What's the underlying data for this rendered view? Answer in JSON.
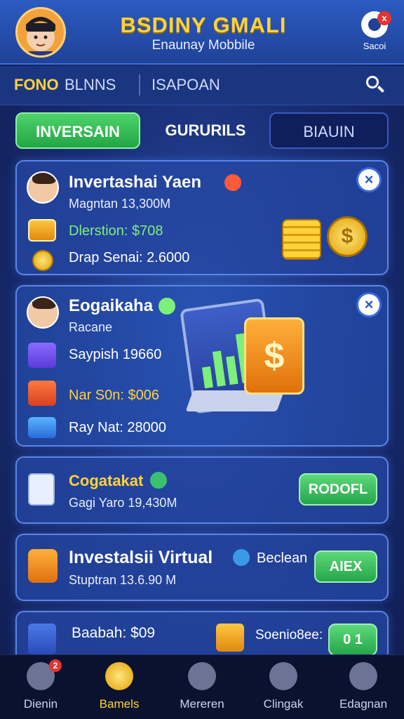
{
  "header": {
    "title": "BSDINY GMALI",
    "subtitle": "Enaunay Mobbile",
    "settings_label": "Sacoi",
    "settings_badge": "x"
  },
  "nav": {
    "items": [
      "FONO",
      "BLNNS",
      "ISAPOAN"
    ]
  },
  "tabs": [
    "INVERSAIN",
    "GURURILS",
    "BIAUIN"
  ],
  "cards": [
    {
      "title": "Invertashai Yaen",
      "subtitle": "Magntan 13,300M",
      "row1": "Dlerstion: $708",
      "row2": "Drap Senai: 2.6000",
      "close": "×"
    },
    {
      "title": "Eogaikaha",
      "subtitle": "Racane",
      "row1": "Saypish 19660",
      "row2": "Nar S0n: $006",
      "row3": "Ray Nat: 28000",
      "close": "×"
    },
    {
      "title": "Cogatakat",
      "subtitle": "Gagi Yaro 19,430M",
      "button": "RODOFL"
    },
    {
      "title": "Investalsii Virtual",
      "subtitle": "Stuptran 13.6.90 M",
      "side_label": "Beclean",
      "button": "AIEX"
    },
    {
      "title": "Baabah: $09",
      "side_label": "Soenio8ee:",
      "button": "0 1"
    }
  ],
  "bottom_nav": {
    "items": [
      {
        "label": "Dienin",
        "icon": "home-icon",
        "badge": "2"
      },
      {
        "label": "Bamels",
        "icon": "coin-icon"
      },
      {
        "label": "Mereren",
        "icon": "plus-icon"
      },
      {
        "label": "Clingak",
        "icon": "refresh-icon"
      },
      {
        "label": "Edagnan",
        "icon": "menu-icon"
      }
    ],
    "active_index": 1
  },
  "colors": {
    "accent_gold": "#ffd23a",
    "accent_green": "#26a54a",
    "background": "#1a2f78"
  }
}
